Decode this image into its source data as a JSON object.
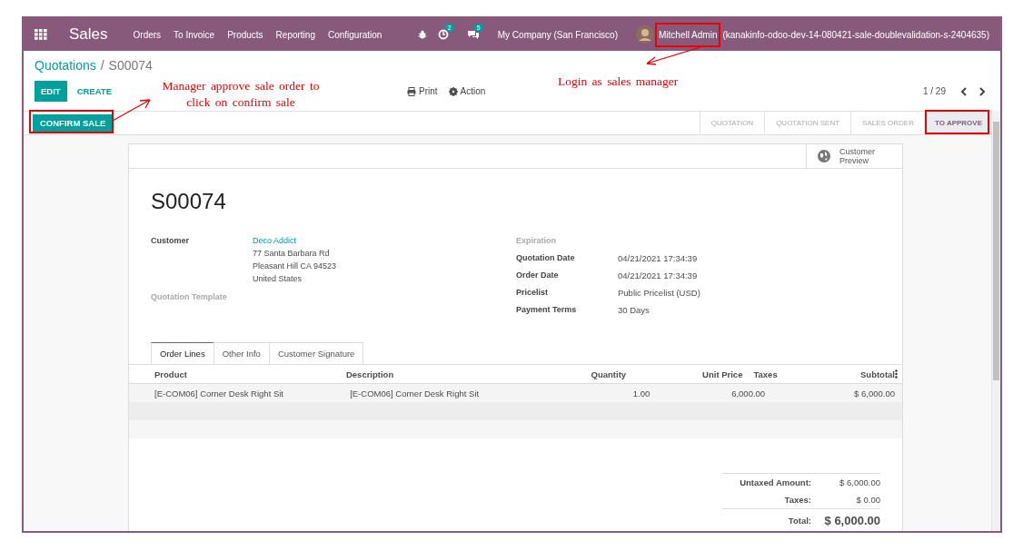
{
  "navbar": {
    "app_name": "Sales",
    "menu": [
      "Orders",
      "To Invoice",
      "Products",
      "Reporting",
      "Configuration"
    ],
    "activity_count": "2",
    "message_count": "5",
    "company": "My Company (San Francisco)",
    "user": "Mitchell Admin",
    "database": "(kanakinfo-odoo-dev-14-080421-sale-doublevalidation-s-2404635)"
  },
  "breadcrumb": {
    "parent": "Quotations",
    "separator": "/",
    "current": "S00074"
  },
  "buttons": {
    "edit": "EDIT",
    "create": "CREATE",
    "print": "Print",
    "action": "Action"
  },
  "pager": "1 / 29",
  "confirm_button": "CONFIRM SALE",
  "stages": [
    {
      "label": "QUOTATION",
      "selected": false
    },
    {
      "label": "QUOTATION SENT",
      "selected": false
    },
    {
      "label": "SALES ORDER",
      "selected": false
    },
    {
      "label": "TO APPROVE",
      "selected": true
    }
  ],
  "customer_preview": "Customer Preview",
  "record_name": "S00074",
  "customer": {
    "label": "Customer",
    "name": "Deco Addict",
    "address": [
      "77 Santa Barbara Rd",
      "Pleasant Hill CA 94523",
      "United States"
    ]
  },
  "quotation_template": {
    "label": "Quotation Template",
    "greyed": true
  },
  "right_fields": [
    {
      "label": "Expiration",
      "greyed": true
    },
    {
      "label": "Quotation Date",
      "greyed": false,
      "value": "04/21/2021 17:34:39"
    },
    {
      "label": "Order Date",
      "greyed": false,
      "value": "04/21/2021 17:34:39"
    },
    {
      "label": "Pricelist",
      "greyed": false,
      "value": "Public Pricelist (USD)"
    },
    {
      "label": "Payment Terms",
      "greyed": false,
      "value": "30 Days"
    }
  ],
  "tabs": [
    {
      "label": "Order Lines",
      "selected": true
    },
    {
      "label": "Other Info",
      "selected": false
    },
    {
      "label": "Customer Signature",
      "selected": false
    }
  ],
  "table": {
    "columns": [
      "Product",
      "Description",
      "Quantity",
      "Unit Price",
      "Taxes",
      "Subtotal"
    ],
    "rows": [
      {
        "product": "[E-COM06] Corner Desk Right Sit",
        "description": "[E-COM06] Corner Desk Right Sit",
        "quantity": "1.00",
        "unit_price": "6,000.00",
        "subtotal": "$ 6,000.00"
      }
    ]
  },
  "totals": [
    {
      "kind": "line",
      "label": "Untaxed Amount:",
      "value": "$ 6,000.00"
    },
    {
      "kind": "line",
      "label": "Taxes:",
      "value": "$ 0.00"
    },
    {
      "kind": "total",
      "label": "Total:",
      "value": "$ 6,000.00"
    }
  ],
  "annotations": [
    {
      "text": "Manager approve sale order to click on confirm sale"
    },
    {
      "text": "Login as sales manager"
    }
  ]
}
